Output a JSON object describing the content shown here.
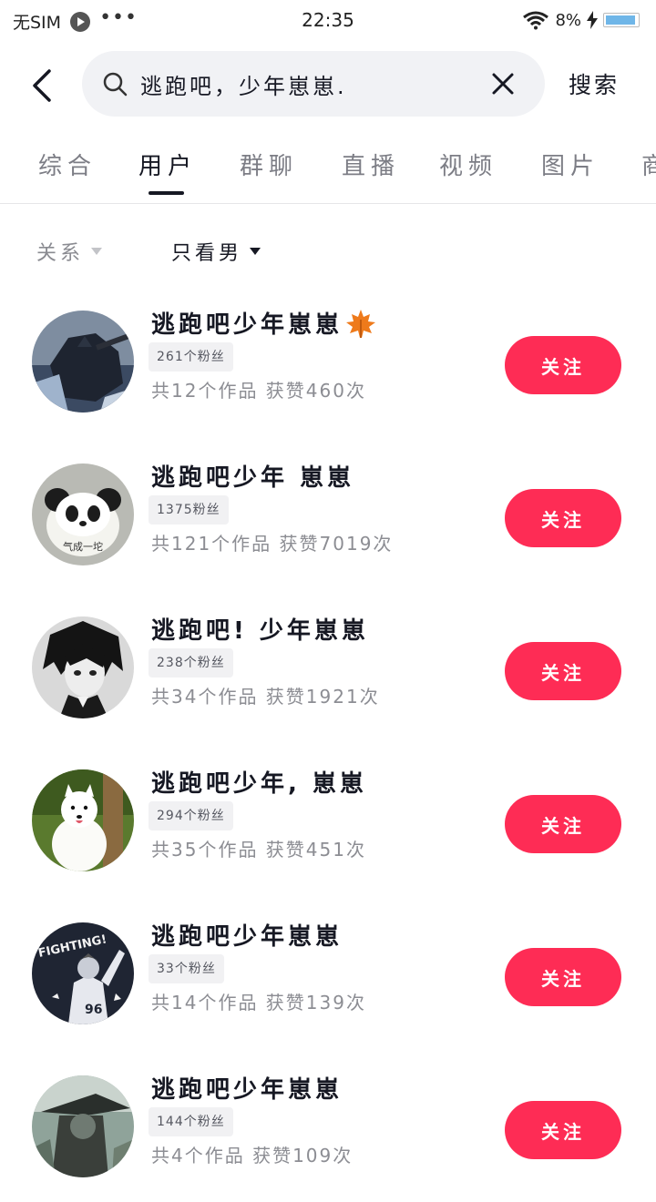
{
  "status_bar": {
    "carrier": "无SIM",
    "dots": "•••",
    "time": "22:35",
    "battery_percent": "8%",
    "battery_level": 0.08
  },
  "search": {
    "query": "逃跑吧，少年崽崽.",
    "button_label": "搜索"
  },
  "tabs": [
    {
      "label": "综合",
      "active": false
    },
    {
      "label": "用户",
      "active": true
    },
    {
      "label": "群聊",
      "active": false
    },
    {
      "label": "直播",
      "active": false
    },
    {
      "label": "视频",
      "active": false
    },
    {
      "label": "图片",
      "active": false
    },
    {
      "label": "商",
      "active": false
    }
  ],
  "filters": {
    "relation": "关系",
    "gender": "只看男"
  },
  "users": [
    {
      "name": "逃跑吧少年崽崽",
      "emoji": "maple-leaf",
      "fans": "261个粉丝",
      "meta": "共12个作品  获赞460次",
      "follow_label": "关注",
      "avatar": "dark-figure"
    },
    {
      "name": "逃跑吧少年 崽崽",
      "fans": "1375粉丝",
      "meta": "共121个作品  获赞7019次",
      "follow_label": "关注",
      "avatar": "panda",
      "avatar_caption": "气成一坨"
    },
    {
      "name": "逃跑吧! 少年崽崽",
      "fans": "238个粉丝",
      "meta": "共34个作品  获赞1921次",
      "follow_label": "关注",
      "avatar": "anime-boy"
    },
    {
      "name": "逃跑吧少年, 崽崽",
      "fans": "294个粉丝",
      "meta": "共35个作品  获赞451次",
      "follow_label": "关注",
      "avatar": "white-dog"
    },
    {
      "name": "逃跑吧少年崽崽",
      "fans": "33个粉丝",
      "meta": "共14个作品  获赞139次",
      "follow_label": "关注",
      "avatar": "fighting",
      "avatar_caption": "FIGHTING!",
      "avatar_jersey": "96"
    },
    {
      "name": "逃跑吧少年崽崽",
      "fans": "144个粉丝",
      "meta": "共4个作品  获赞109次",
      "follow_label": "关注",
      "avatar": "hat-figure"
    }
  ]
}
